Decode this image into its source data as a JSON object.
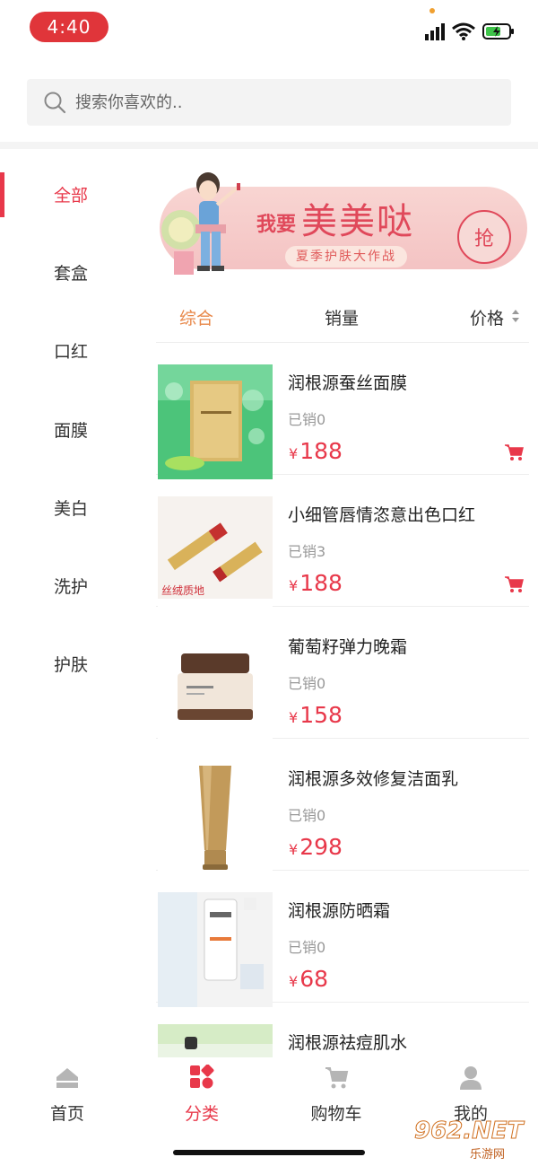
{
  "status_bar": {
    "time": "4:40"
  },
  "search": {
    "placeholder": "搜索你喜欢的.."
  },
  "sidebar": {
    "items": [
      {
        "label": "全部",
        "active": true
      },
      {
        "label": "套盒"
      },
      {
        "label": "口红"
      },
      {
        "label": "面膜"
      },
      {
        "label": "美白"
      },
      {
        "label": "洗护"
      },
      {
        "label": "护肤"
      }
    ]
  },
  "banner": {
    "small_text": "我要",
    "big_text": "美美哒",
    "sub_text": "夏季护肤大作战",
    "button_label": "抢"
  },
  "sort_tabs": [
    {
      "label": "综合",
      "active": true
    },
    {
      "label": "销量"
    },
    {
      "label": "价格"
    }
  ],
  "products": [
    {
      "name": "润根源蚕丝面膜",
      "sold": "已销0",
      "currency": "¥",
      "price": "188",
      "has_cart": true
    },
    {
      "name": "小细管唇情恣意出色口红",
      "sold": "已销3",
      "currency": "¥",
      "price": "188",
      "has_cart": true,
      "thumb_text": "丝绒质地"
    },
    {
      "name": "葡萄籽弹力晚霜",
      "sold": "已销0",
      "currency": "¥",
      "price": "158",
      "has_cart": false
    },
    {
      "name": "润根源多效修复洁面乳",
      "sold": "已销0",
      "currency": "¥",
      "price": "298",
      "has_cart": false
    },
    {
      "name": "润根源防晒霜",
      "sold": "已销0",
      "currency": "¥",
      "price": "68",
      "has_cart": false
    },
    {
      "name": "润根源祛痘肌水",
      "sold": "",
      "currency": "",
      "price": "",
      "has_cart": false
    }
  ],
  "bottom_nav": [
    {
      "label": "首页",
      "icon": "home-icon"
    },
    {
      "label": "分类",
      "icon": "category-icon",
      "active": true
    },
    {
      "label": "购物车",
      "icon": "cart-icon"
    },
    {
      "label": "我的",
      "icon": "user-icon"
    }
  ],
  "watermark": {
    "main": "962.NET",
    "sub": "乐游网"
  },
  "colors": {
    "accent": "#e8384a",
    "sort_active": "#e8884a",
    "time_pill": "#e0353a"
  }
}
